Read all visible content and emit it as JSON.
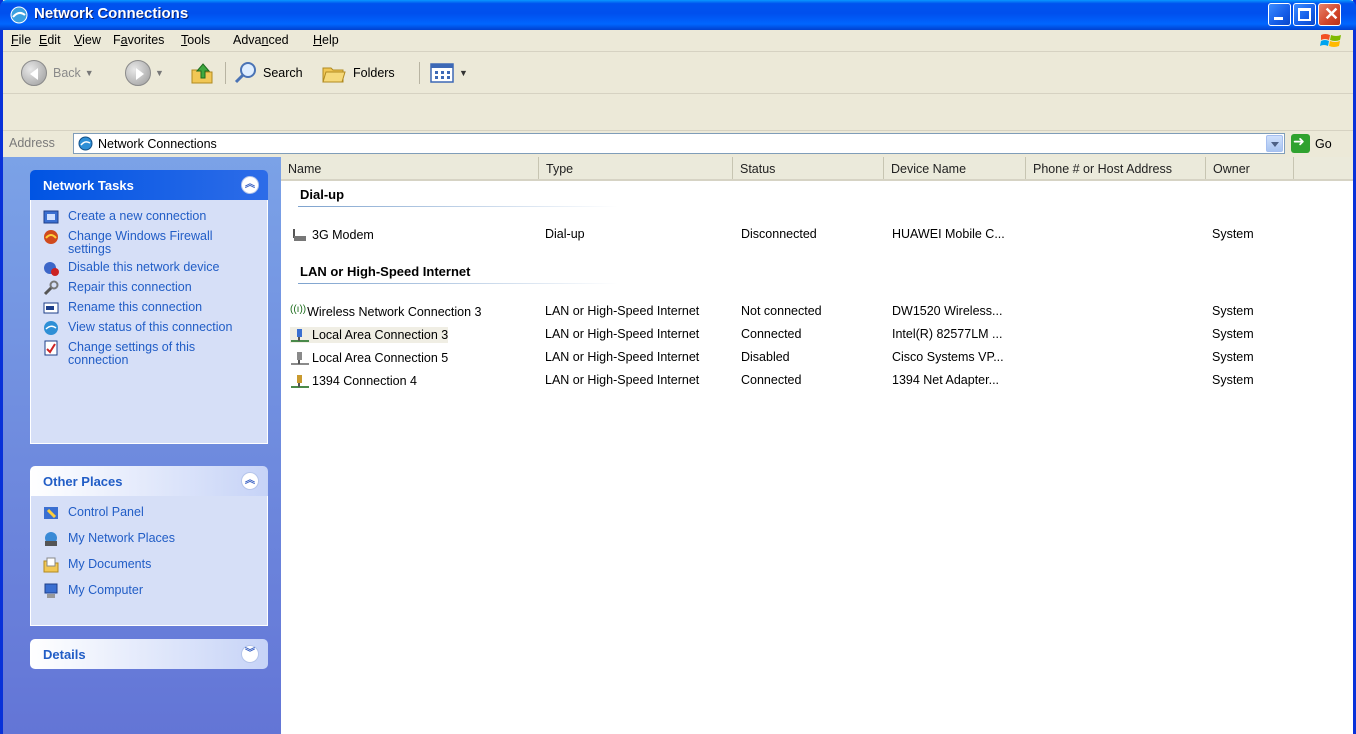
{
  "window": {
    "title": "Network Connections"
  },
  "menu": [
    {
      "label": "File",
      "key": "F",
      "rest": "ile"
    },
    {
      "label": "Edit",
      "key": "E",
      "rest": "dit"
    },
    {
      "label": "View",
      "key": "V",
      "rest": "iew"
    },
    {
      "label": "Favorites",
      "key": "a",
      "pre": "F",
      "rest": "vorites"
    },
    {
      "label": "Tools",
      "key": "T",
      "rest": "ools"
    },
    {
      "label": "Advanced",
      "key": "n",
      "pre": "Adva",
      "rest": "ced"
    },
    {
      "label": "Help",
      "key": "H",
      "rest": "elp"
    }
  ],
  "toolbar": {
    "back_label": "Back",
    "search_label": "Search",
    "folders_label": "Folders"
  },
  "address": {
    "label": "Address",
    "value": "Network Connections",
    "go_label": "Go"
  },
  "sidebar": {
    "network_tasks": {
      "title": "Network Tasks",
      "items": [
        {
          "label": "Create a new connection",
          "icon": "new-connection-icon"
        },
        {
          "label": "Change Windows Firewall settings",
          "icon": "firewall-icon"
        },
        {
          "label": "Disable this network device",
          "icon": "disable-device-icon"
        },
        {
          "label": "Repair this connection",
          "icon": "repair-icon"
        },
        {
          "label": "Rename this connection",
          "icon": "rename-icon"
        },
        {
          "label": "View status of this connection",
          "icon": "status-icon"
        },
        {
          "label": "Change settings of this connection",
          "icon": "settings-icon"
        }
      ]
    },
    "other_places": {
      "title": "Other Places",
      "items": [
        {
          "label": "Control Panel",
          "icon": "control-panel-icon"
        },
        {
          "label": "My Network Places",
          "icon": "network-places-icon"
        },
        {
          "label": "My Documents",
          "icon": "documents-icon"
        },
        {
          "label": "My Computer",
          "icon": "computer-icon"
        }
      ]
    },
    "details": {
      "title": "Details"
    }
  },
  "columns": [
    "Name",
    "Type",
    "Status",
    "Device Name",
    "Phone # or Host Address",
    "Owner"
  ],
  "groups": [
    {
      "title": "Dial-up",
      "rows": [
        {
          "name": "3G Modem",
          "type": "Dial-up",
          "status": "Disconnected",
          "device": "HUAWEI Mobile C...",
          "phone": "",
          "owner": "System",
          "icon": "modem-icon"
        }
      ]
    },
    {
      "title": "LAN or High-Speed Internet",
      "rows": [
        {
          "name": "Wireless Network Connection 3",
          "type": "LAN or High-Speed Internet",
          "status": "Not connected",
          "device": "DW1520 Wireless...",
          "phone": "",
          "owner": "System",
          "icon": "wireless-icon"
        },
        {
          "name": "Local Area Connection 3",
          "type": "LAN or High-Speed Internet",
          "status": "Connected",
          "device": "Intel(R) 82577LM ...",
          "phone": "",
          "owner": "System",
          "icon": "lan-icon"
        },
        {
          "name": "Local Area Connection 5",
          "type": "LAN or High-Speed Internet",
          "status": "Disabled",
          "device": "Cisco Systems VP...",
          "phone": "",
          "owner": "System",
          "icon": "lan-disabled-icon"
        },
        {
          "name": "1394 Connection 4",
          "type": "LAN or High-Speed Internet",
          "status": "Connected",
          "device": "1394 Net Adapter...",
          "phone": "",
          "owner": "System",
          "icon": "lan-icon"
        }
      ]
    }
  ],
  "colors": {
    "title_bar": "#0053ee",
    "sidebar_link": "#215dc6",
    "sidebar_bg": "#6375d6"
  }
}
